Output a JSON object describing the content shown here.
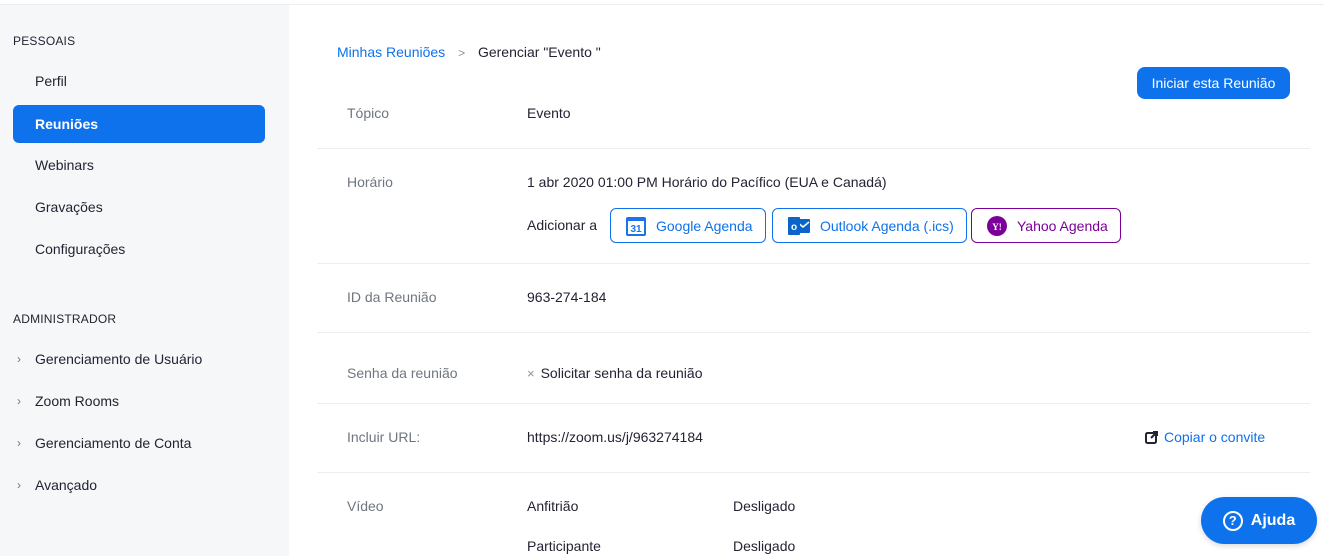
{
  "sidebar": {
    "personal_heading": "PESSOAIS",
    "personal_items": [
      {
        "label": "Perfil",
        "active": false
      },
      {
        "label": "Reuniões",
        "active": true
      },
      {
        "label": "Webinars",
        "active": false
      },
      {
        "label": "Gravações",
        "active": false
      },
      {
        "label": "Configurações",
        "active": false
      }
    ],
    "admin_heading": "ADMINISTRADOR",
    "admin_items": [
      {
        "label": "Gerenciamento de Usuário",
        "icon": "chevron-right-icon"
      },
      {
        "label": "Zoom Rooms",
        "icon": "chevron-right-icon"
      },
      {
        "label": "Gerenciamento de Conta",
        "icon": "chevron-right-icon"
      },
      {
        "label": "Avançado",
        "icon": "chevron-right-icon"
      }
    ]
  },
  "breadcrumb": {
    "parent": "Minhas Reuniões",
    "separator": ">",
    "current": "Gerenciar \"Evento \""
  },
  "start_button": "Iniciar esta Reunião",
  "details": {
    "topic": {
      "label": "Tópico",
      "value": "Evento"
    },
    "time": {
      "label": "Horário",
      "value": "1 abr 2020 01:00 PM Horário do Pacífico (EUA e Canadá)",
      "add_to": "Adicionar a",
      "calendars": [
        {
          "label": "Google Agenda",
          "icon": "google-calendar-icon",
          "icon_text": "31"
        },
        {
          "label": "Outlook Agenda (.ics)",
          "icon": "outlook-icon",
          "icon_text": "o"
        },
        {
          "label": "Yahoo Agenda",
          "icon": "yahoo-icon",
          "icon_text": "Y!"
        }
      ]
    },
    "meeting_id": {
      "label": "ID da Reunião",
      "value": "963-274-184"
    },
    "password": {
      "label": "Senha da reunião",
      "value": "Solicitar senha da reunião",
      "mark": "×"
    },
    "url": {
      "label": "Incluir URL:",
      "value": "https://zoom.us/j/963274184",
      "copy": "Copiar o convite"
    },
    "video": {
      "label": "Vídeo",
      "rows": [
        {
          "who": "Anfitrião",
          "state": "Desligado"
        },
        {
          "who": "Participante",
          "state": "Desligado"
        }
      ]
    }
  },
  "help_button": {
    "label": "Ajuda",
    "icon_text": "?"
  },
  "colors": {
    "accent": "#0e72ed",
    "yahoo": "#7b0099",
    "sidebar_bg": "#f6f7f9",
    "outlook": "#0a64c9"
  }
}
